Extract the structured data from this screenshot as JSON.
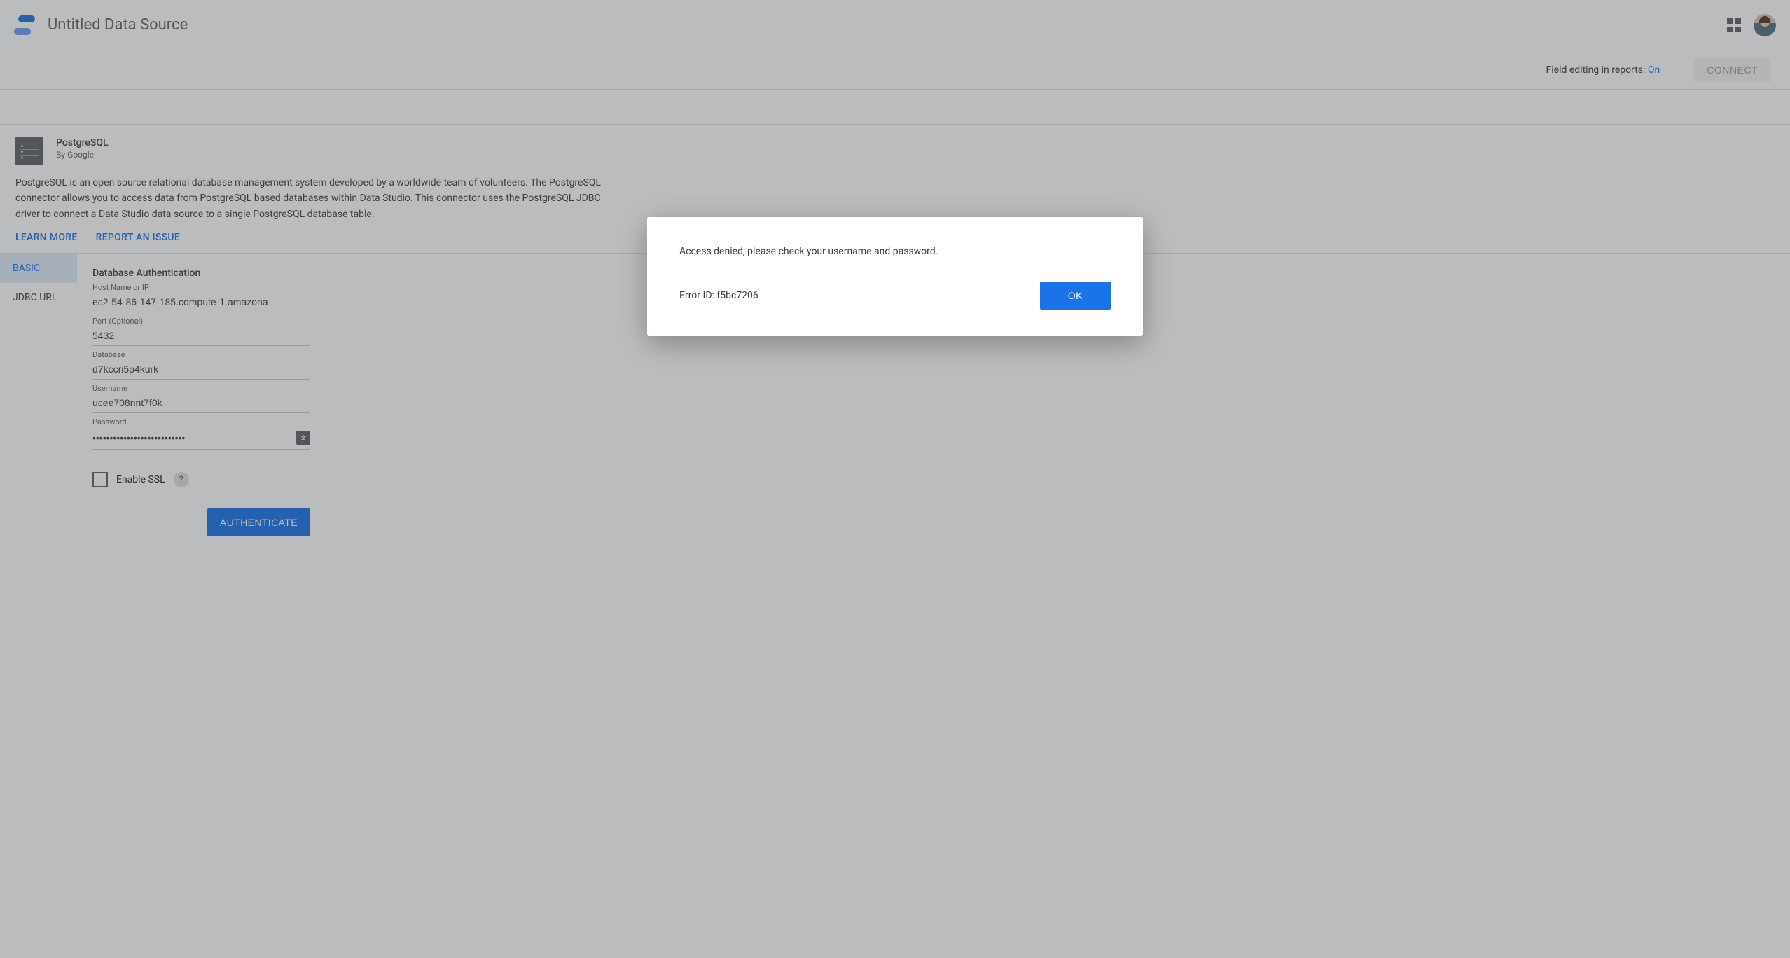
{
  "header": {
    "title": "Untitled Data Source"
  },
  "subheader": {
    "field_editing_prefix": "Field editing in reports: ",
    "field_editing_state": "On",
    "connect_label": "CONNECT"
  },
  "connector": {
    "name": "PostgreSQL",
    "byline": "By Google",
    "description": "PostgreSQL is an open source relational database management system developed by a worldwide team of volunteers. The PostgreSQL connector allows you to access data from PostgreSQL based databases within Data Studio. This connector uses the PostgreSQL JDBC driver to connect a Data Studio data source to a single PostgreSQL database table.",
    "learn_more": "LEARN MORE",
    "report_issue": "REPORT AN ISSUE"
  },
  "tabs": {
    "basic": "BASIC",
    "jdbc": "JDBC URL"
  },
  "form": {
    "heading": "Database Authentication",
    "host_label": "Host Name or IP",
    "host_value": "ec2-54-86-147-185.compute-1.amazona",
    "port_label": "Port (Optional)",
    "port_value": "5432",
    "database_label": "Database",
    "database_value": "d7kccri5p4kurk",
    "username_label": "Username",
    "username_value": "ucee708nnt7f0k",
    "password_label": "Password",
    "password_value": "•••••••••••••••••••••••••••",
    "enable_ssl_label": "Enable SSL",
    "help_char": "?",
    "authenticate_label": "AUTHENTICATE"
  },
  "dialog": {
    "message": "Access denied, please check your username and password.",
    "error_id": "Error ID: f5bc7206",
    "ok": "OK"
  }
}
